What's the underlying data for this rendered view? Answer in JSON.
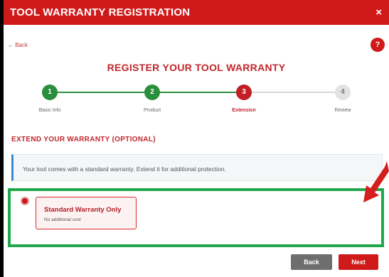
{
  "dialog": {
    "title": "TOOL WARRANTY REGISTRATION",
    "close_glyph": "×",
    "back_link": "← Back",
    "help_glyph": "?",
    "heading": "REGISTER YOUR TOOL WARRANTY"
  },
  "steps": [
    {
      "number": "1",
      "label": "Basic Info",
      "state": "complete"
    },
    {
      "number": "2",
      "label": "Product",
      "state": "complete"
    },
    {
      "number": "3",
      "label": "Extension",
      "state": "active"
    },
    {
      "number": "4",
      "label": "Review",
      "state": "pending"
    }
  ],
  "extension": {
    "section_title": "EXTEND YOUR WARRANTY (OPTIONAL)",
    "info_text": "Your tool comes with a standard warranty. Extend it for additional protection.",
    "option": {
      "title": "Standard Warranty Only",
      "subtitle": "No additional cost",
      "selected": true
    }
  },
  "footer": {
    "back_label": "Back",
    "next_label": "Next"
  },
  "colors": {
    "brand_red": "#d01a1a",
    "step_complete": "#2a8f3b",
    "highlight_green": "#1fa84a",
    "info_accent": "#3a8bd6"
  },
  "icons": {
    "close": "close-icon",
    "help": "help-icon",
    "annotation_arrow": "arrow-annotation-icon"
  }
}
